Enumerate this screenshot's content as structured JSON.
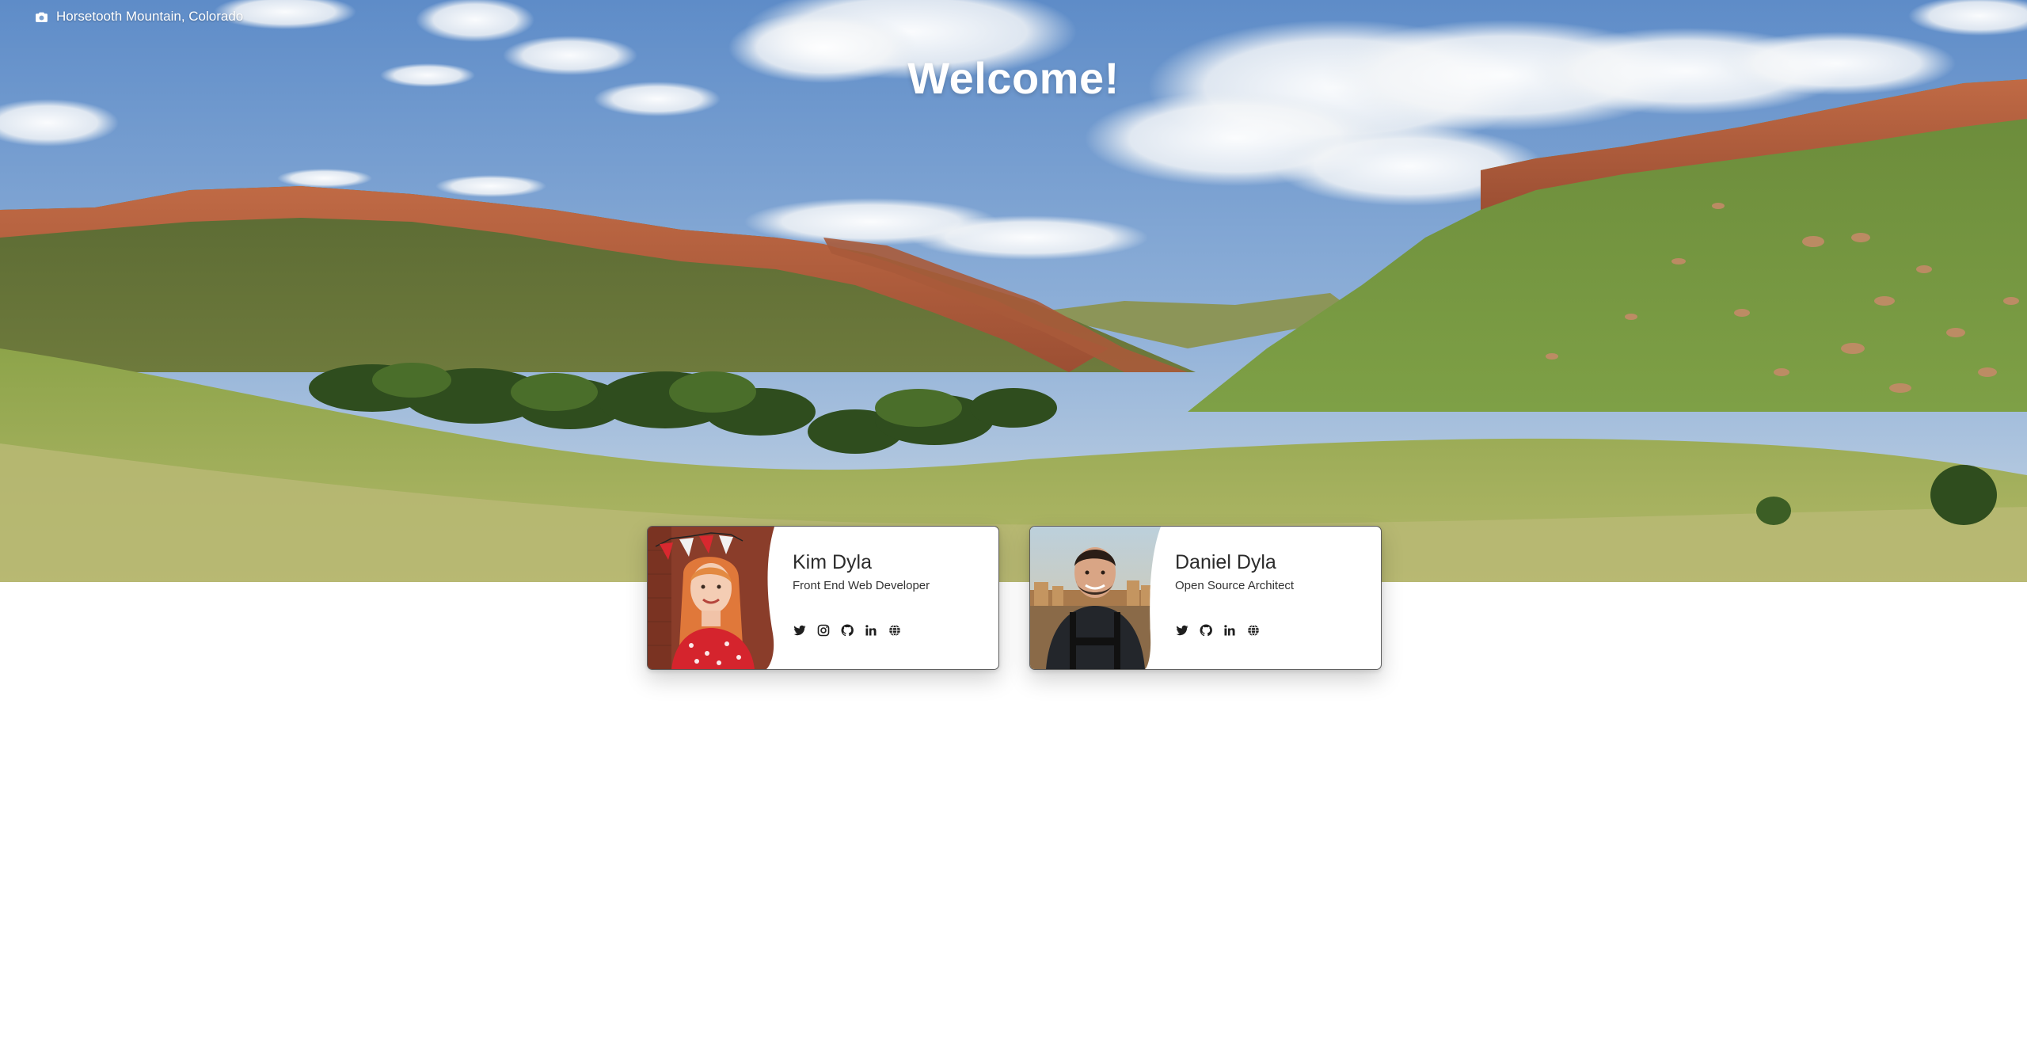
{
  "hero": {
    "photo_credit": "Horsetooth Mountain, Colorado",
    "welcome": "Welcome!",
    "colors": {
      "sky_top": "#6a95cc",
      "sky_bottom": "#b9cde0",
      "rock": "#b2603f",
      "hill_green": "#6f8a3a",
      "grass": "#a8b05c"
    }
  },
  "people": [
    {
      "name": "Kim Dyla",
      "role": "Front End Web Developer",
      "socials": [
        "twitter-icon",
        "instagram-icon",
        "github-icon",
        "linkedin-icon",
        "globe-icon"
      ]
    },
    {
      "name": "Daniel Dyla",
      "role": "Open Source Architect",
      "socials": [
        "twitter-icon",
        "github-icon",
        "linkedin-icon",
        "globe-icon"
      ]
    }
  ]
}
